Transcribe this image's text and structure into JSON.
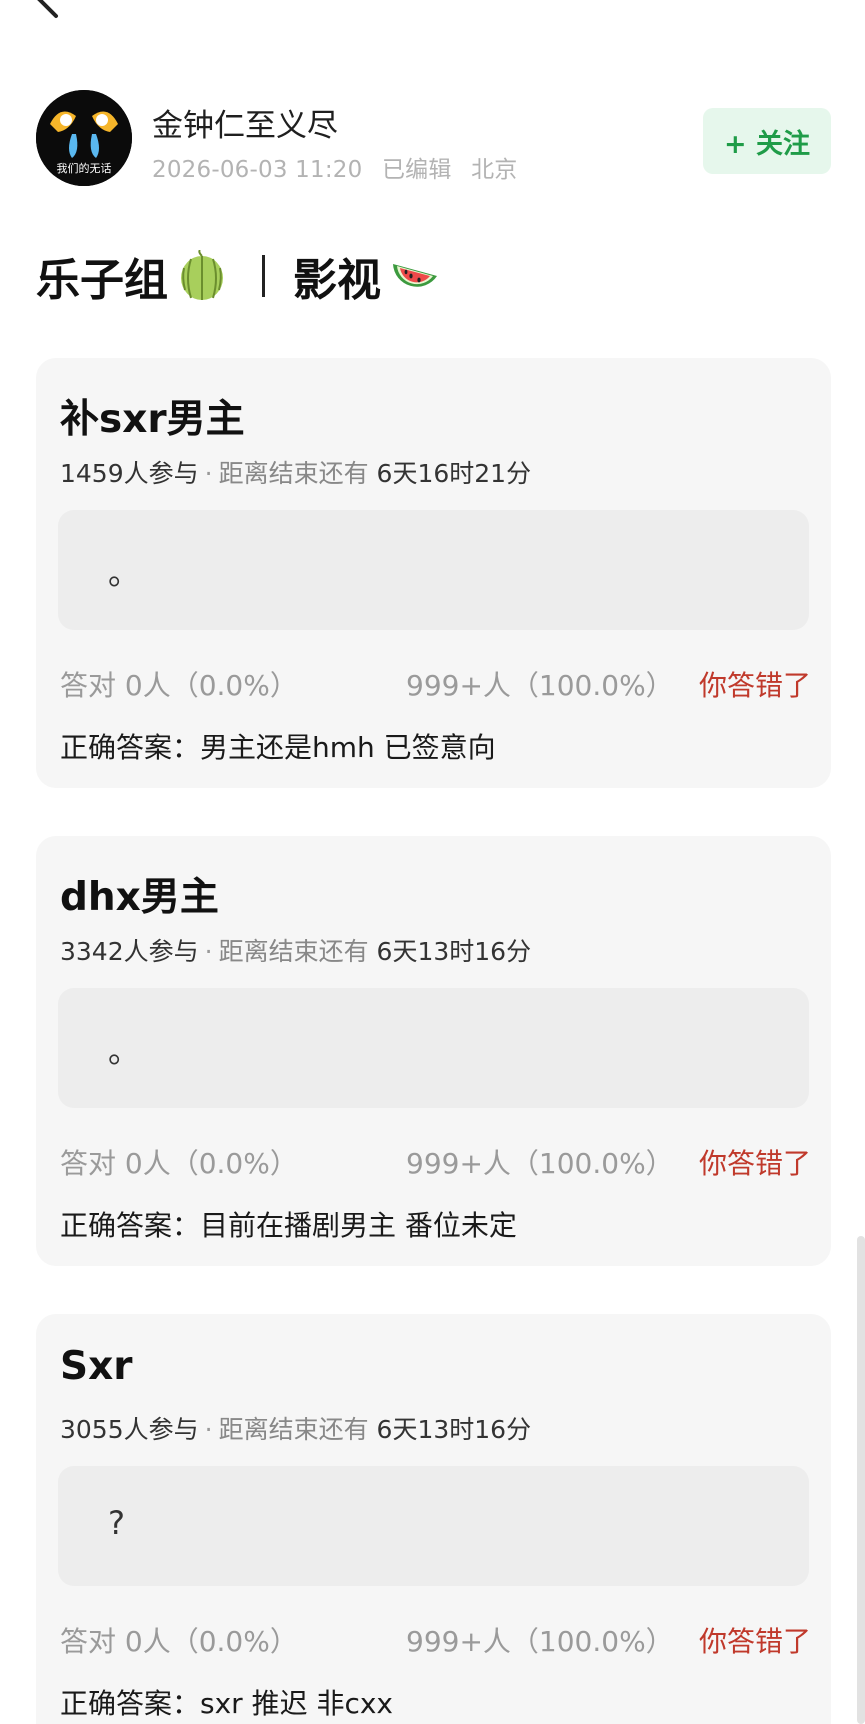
{
  "author": {
    "name": "金钟仁至义尽",
    "avatar_text": "我们的无话",
    "date": "2026-06-03 11:20",
    "edited": "已编辑",
    "location": "北京",
    "follow_label": "+ 关注"
  },
  "channel": {
    "left": "乐子组",
    "left_emoji": "melon-icon",
    "right": "影视",
    "right_emoji": "watermelon-icon"
  },
  "cards": [
    {
      "title": "补sxr男主",
      "participants": "1459人参与",
      "deadline_label": "距离结束还有",
      "deadline": "6天16时21分",
      "answer": "。",
      "correct_stat": "答对  0人（0.0%）",
      "wrong_stat": "999+人（100.0%）",
      "wrong_label": "你答错了",
      "correct_answer": "正确答案：男主还是hmh 已签意向"
    },
    {
      "title": "dhx男主",
      "participants": "3342人参与",
      "deadline_label": "距离结束还有",
      "deadline": "6天13时16分",
      "answer": "。",
      "correct_stat": "答对  0人（0.0%）",
      "wrong_stat": "999+人（100.0%）",
      "wrong_label": "你答错了",
      "correct_answer": "正确答案：目前在播剧男主 番位未定"
    },
    {
      "title": "Sxr",
      "participants": "3055人参与",
      "deadline_label": "距离结束还有",
      "deadline": "6天13时16分",
      "answer": "?",
      "correct_stat": "答对  0人（0.0%）",
      "wrong_stat": "999+人（100.0%）",
      "wrong_label": "你答错了",
      "correct_answer": "正确答案：sxr 推迟 非cxx"
    }
  ],
  "colors": {
    "follow_bg": "#e6f7ec",
    "follow_text": "#1f9c48",
    "wrong": "#c0392b",
    "card_bg": "#f6f6f6"
  }
}
